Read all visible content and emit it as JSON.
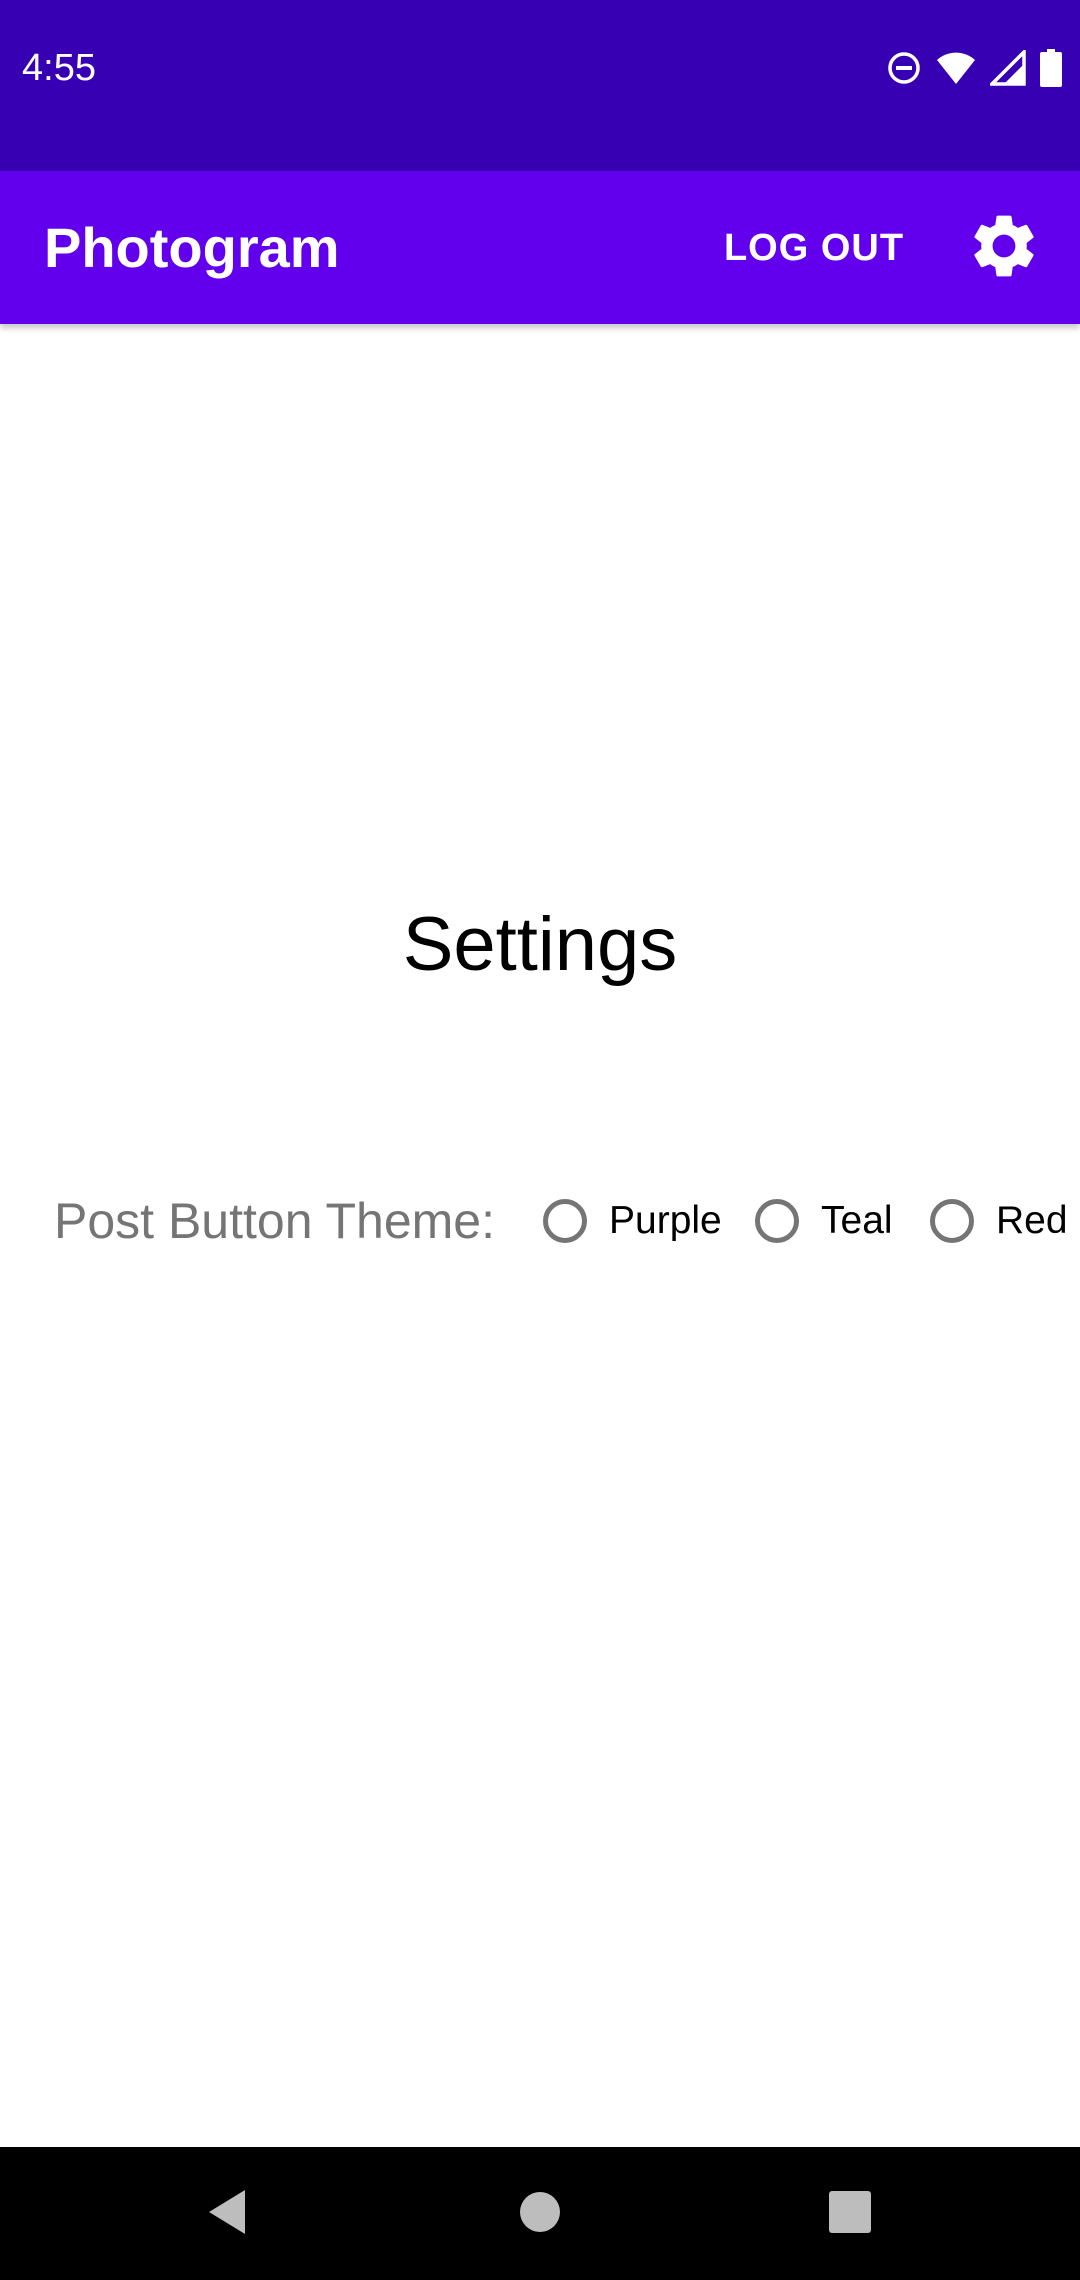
{
  "status_bar": {
    "time": "4:55",
    "icons": [
      "do-not-disturb-icon",
      "wifi-icon",
      "cell-signal-icon",
      "battery-icon"
    ]
  },
  "app_bar": {
    "title": "Photogram",
    "logout_label": "LOG OUT",
    "settings_icon": "gear-icon"
  },
  "main": {
    "heading": "Settings",
    "theme": {
      "label": "Post Button Theme:",
      "options": [
        {
          "label": "Purple",
          "selected": false
        },
        {
          "label": "Teal",
          "selected": false
        },
        {
          "label": "Red",
          "selected": false
        }
      ]
    }
  },
  "nav_bar": {
    "icons": [
      "back-icon",
      "home-icon",
      "recents-icon"
    ]
  },
  "colors": {
    "status_bar": "#3700b3",
    "app_bar": "#6200ee",
    "label_gray": "#757575",
    "background": "#ffffff"
  }
}
